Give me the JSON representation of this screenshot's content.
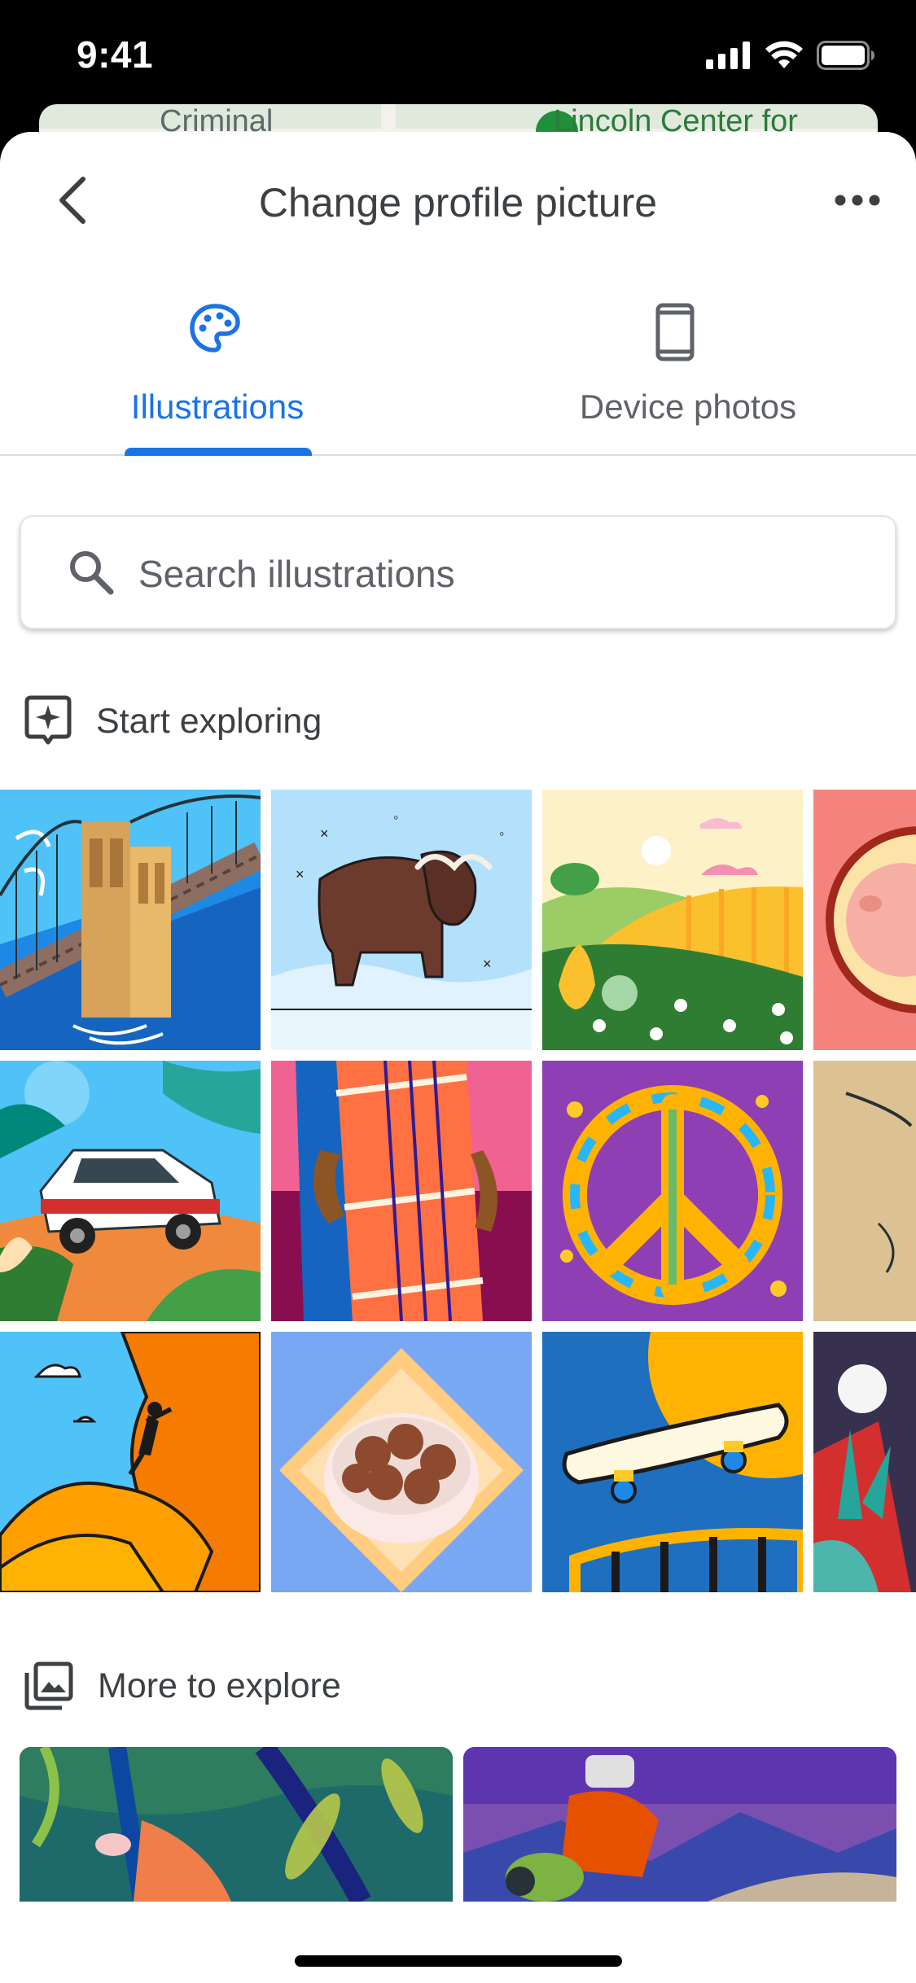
{
  "status_bar": {
    "time": "9:41",
    "icons": [
      "signal-icon",
      "wifi-icon",
      "battery-icon"
    ]
  },
  "map_peek": {
    "label_left": "Criminal",
    "label_right": "Lincoln Center for"
  },
  "header": {
    "title": "Change profile picture",
    "back_icon": "chevron-left-icon",
    "more_icon": "more-horiz-icon"
  },
  "tabs": [
    {
      "label": "Illustrations",
      "icon": "palette-icon",
      "selected": true
    },
    {
      "label": "Device photos",
      "icon": "smartphone-icon",
      "selected": false
    }
  ],
  "search": {
    "placeholder": "Search illustrations",
    "value": ""
  },
  "sections": {
    "start_exploring": {
      "label": "Start exploring",
      "icon": "sparkle-frame-icon"
    },
    "more_to_explore": {
      "label": "More to explore",
      "icon": "photo-library-icon"
    }
  },
  "illustrations": [
    "bridge-illustration",
    "musk-ox-illustration",
    "hills-illustration",
    "pig-illustration",
    "rally-car-illustration",
    "saree-illustration",
    "peace-sign-illustration",
    "bird-illustration",
    "climber-illustration",
    "sweets-bowl-illustration",
    "skateboard-illustration",
    "plant-bird-illustration"
  ],
  "more_cards": [
    "jungle-hand-illustration",
    "motorcyclist-illustration"
  ],
  "colors": {
    "accent": "#1a73e8",
    "text_primary": "#3c4043",
    "text_secondary": "#5f6368",
    "divider": "#dadce0"
  }
}
